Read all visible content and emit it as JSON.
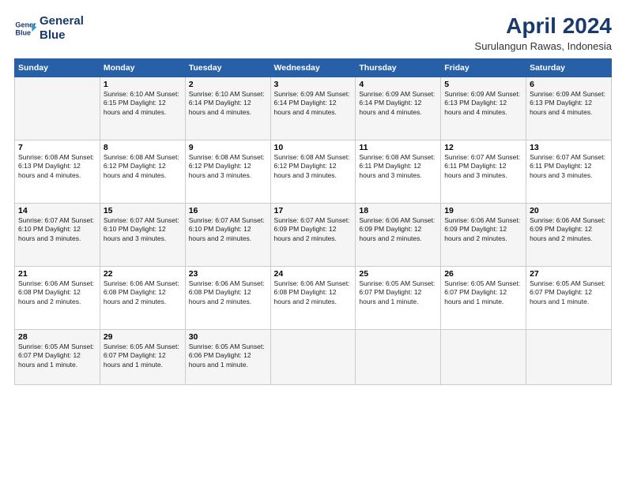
{
  "header": {
    "logo_line1": "General",
    "logo_line2": "Blue",
    "month_year": "April 2024",
    "location": "Surulangun Rawas, Indonesia"
  },
  "weekdays": [
    "Sunday",
    "Monday",
    "Tuesday",
    "Wednesday",
    "Thursday",
    "Friday",
    "Saturday"
  ],
  "weeks": [
    [
      {
        "day": "",
        "info": ""
      },
      {
        "day": "1",
        "info": "Sunrise: 6:10 AM\nSunset: 6:15 PM\nDaylight: 12 hours\nand 4 minutes."
      },
      {
        "day": "2",
        "info": "Sunrise: 6:10 AM\nSunset: 6:14 PM\nDaylight: 12 hours\nand 4 minutes."
      },
      {
        "day": "3",
        "info": "Sunrise: 6:09 AM\nSunset: 6:14 PM\nDaylight: 12 hours\nand 4 minutes."
      },
      {
        "day": "4",
        "info": "Sunrise: 6:09 AM\nSunset: 6:14 PM\nDaylight: 12 hours\nand 4 minutes."
      },
      {
        "day": "5",
        "info": "Sunrise: 6:09 AM\nSunset: 6:13 PM\nDaylight: 12 hours\nand 4 minutes."
      },
      {
        "day": "6",
        "info": "Sunrise: 6:09 AM\nSunset: 6:13 PM\nDaylight: 12 hours\nand 4 minutes."
      }
    ],
    [
      {
        "day": "7",
        "info": "Sunrise: 6:08 AM\nSunset: 6:13 PM\nDaylight: 12 hours\nand 4 minutes."
      },
      {
        "day": "8",
        "info": "Sunrise: 6:08 AM\nSunset: 6:12 PM\nDaylight: 12 hours\nand 4 minutes."
      },
      {
        "day": "9",
        "info": "Sunrise: 6:08 AM\nSunset: 6:12 PM\nDaylight: 12 hours\nand 3 minutes."
      },
      {
        "day": "10",
        "info": "Sunrise: 6:08 AM\nSunset: 6:12 PM\nDaylight: 12 hours\nand 3 minutes."
      },
      {
        "day": "11",
        "info": "Sunrise: 6:08 AM\nSunset: 6:11 PM\nDaylight: 12 hours\nand 3 minutes."
      },
      {
        "day": "12",
        "info": "Sunrise: 6:07 AM\nSunset: 6:11 PM\nDaylight: 12 hours\nand 3 minutes."
      },
      {
        "day": "13",
        "info": "Sunrise: 6:07 AM\nSunset: 6:11 PM\nDaylight: 12 hours\nand 3 minutes."
      }
    ],
    [
      {
        "day": "14",
        "info": "Sunrise: 6:07 AM\nSunset: 6:10 PM\nDaylight: 12 hours\nand 3 minutes."
      },
      {
        "day": "15",
        "info": "Sunrise: 6:07 AM\nSunset: 6:10 PM\nDaylight: 12 hours\nand 3 minutes."
      },
      {
        "day": "16",
        "info": "Sunrise: 6:07 AM\nSunset: 6:10 PM\nDaylight: 12 hours\nand 2 minutes."
      },
      {
        "day": "17",
        "info": "Sunrise: 6:07 AM\nSunset: 6:09 PM\nDaylight: 12 hours\nand 2 minutes."
      },
      {
        "day": "18",
        "info": "Sunrise: 6:06 AM\nSunset: 6:09 PM\nDaylight: 12 hours\nand 2 minutes."
      },
      {
        "day": "19",
        "info": "Sunrise: 6:06 AM\nSunset: 6:09 PM\nDaylight: 12 hours\nand 2 minutes."
      },
      {
        "day": "20",
        "info": "Sunrise: 6:06 AM\nSunset: 6:09 PM\nDaylight: 12 hours\nand 2 minutes."
      }
    ],
    [
      {
        "day": "21",
        "info": "Sunrise: 6:06 AM\nSunset: 6:08 PM\nDaylight: 12 hours\nand 2 minutes."
      },
      {
        "day": "22",
        "info": "Sunrise: 6:06 AM\nSunset: 6:08 PM\nDaylight: 12 hours\nand 2 minutes."
      },
      {
        "day": "23",
        "info": "Sunrise: 6:06 AM\nSunset: 6:08 PM\nDaylight: 12 hours\nand 2 minutes."
      },
      {
        "day": "24",
        "info": "Sunrise: 6:06 AM\nSunset: 6:08 PM\nDaylight: 12 hours\nand 2 minutes."
      },
      {
        "day": "25",
        "info": "Sunrise: 6:05 AM\nSunset: 6:07 PM\nDaylight: 12 hours\nand 1 minute."
      },
      {
        "day": "26",
        "info": "Sunrise: 6:05 AM\nSunset: 6:07 PM\nDaylight: 12 hours\nand 1 minute."
      },
      {
        "day": "27",
        "info": "Sunrise: 6:05 AM\nSunset: 6:07 PM\nDaylight: 12 hours\nand 1 minute."
      }
    ],
    [
      {
        "day": "28",
        "info": "Sunrise: 6:05 AM\nSunset: 6:07 PM\nDaylight: 12 hours\nand 1 minute."
      },
      {
        "day": "29",
        "info": "Sunrise: 6:05 AM\nSunset: 6:07 PM\nDaylight: 12 hours\nand 1 minute."
      },
      {
        "day": "30",
        "info": "Sunrise: 6:05 AM\nSunset: 6:06 PM\nDaylight: 12 hours\nand 1 minute."
      },
      {
        "day": "",
        "info": ""
      },
      {
        "day": "",
        "info": ""
      },
      {
        "day": "",
        "info": ""
      },
      {
        "day": "",
        "info": ""
      }
    ]
  ]
}
